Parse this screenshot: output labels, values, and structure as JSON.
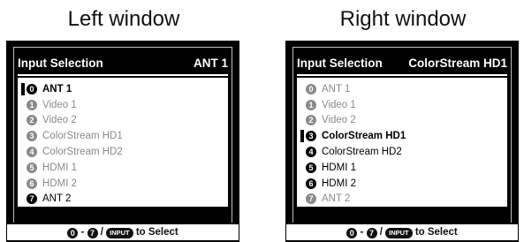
{
  "left": {
    "caption": "Left window",
    "title": "Input Selection",
    "current": "ANT 1",
    "items": [
      {
        "num": "0",
        "label": "ANT 1",
        "state": "selected"
      },
      {
        "num": "1",
        "label": "Video 1",
        "state": "inactive"
      },
      {
        "num": "2",
        "label": "Video 2",
        "state": "inactive"
      },
      {
        "num": "3",
        "label": "ColorStream HD1",
        "state": "inactive"
      },
      {
        "num": "4",
        "label": "ColorStream HD2",
        "state": "inactive"
      },
      {
        "num": "5",
        "label": "HDMI 1",
        "state": "inactive"
      },
      {
        "num": "6",
        "label": "HDMI 2",
        "state": "inactive"
      },
      {
        "num": "7",
        "label": "ANT 2",
        "state": "active"
      }
    ],
    "footer": {
      "key_start": "0",
      "dash": "-",
      "key_end": "7",
      "slash": "/",
      "input_key": "INPUT",
      "action": "to Select"
    }
  },
  "right": {
    "caption": "Right window",
    "title": "Input Selection",
    "current": "ColorStream HD1",
    "items": [
      {
        "num": "0",
        "label": "ANT 1",
        "state": "inactive"
      },
      {
        "num": "1",
        "label": "Video 1",
        "state": "inactive"
      },
      {
        "num": "2",
        "label": "Video 2",
        "state": "inactive"
      },
      {
        "num": "3",
        "label": "ColorStream HD1",
        "state": "selected"
      },
      {
        "num": "4",
        "label": "ColorStream HD2",
        "state": "active"
      },
      {
        "num": "5",
        "label": "HDMI 1",
        "state": "active"
      },
      {
        "num": "6",
        "label": "HDMI 2",
        "state": "active"
      },
      {
        "num": "7",
        "label": "ANT 2",
        "state": "inactive"
      }
    ],
    "footer": {
      "key_start": "0",
      "dash": "-",
      "key_end": "7",
      "slash": "/",
      "input_key": "INPUT",
      "action": "to Select"
    }
  },
  "colors": {
    "background": "#ffffff",
    "window": "#000000",
    "inactive_text": "#8a8a8a",
    "active_text": "#000000"
  }
}
